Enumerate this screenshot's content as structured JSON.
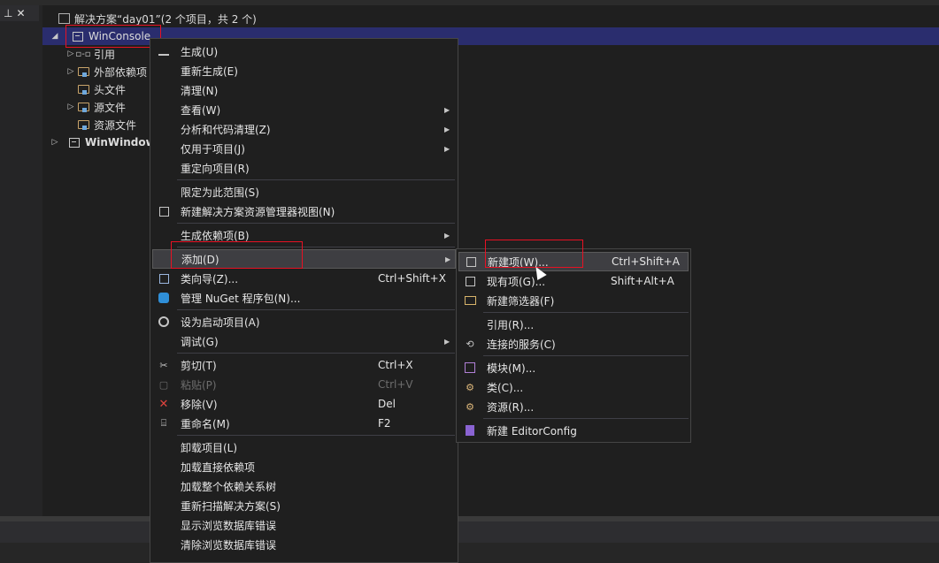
{
  "toolbar": {
    "pin_glyph": "⊥",
    "close_glyph": "✕"
  },
  "tree": {
    "solution": "解决方案“day01”(2 个项目，共 2 个)",
    "project1": "WinConsole",
    "children": [
      "引用",
      "外部依赖项",
      "头文件",
      "源文件",
      "资源文件"
    ],
    "project2": "WinWindow"
  },
  "context_menu": {
    "items": [
      {
        "label": "生成(U)",
        "shortcut": "",
        "arrow": false
      },
      {
        "label": "重新生成(E)",
        "shortcut": "",
        "arrow": false
      },
      {
        "label": "清理(N)",
        "shortcut": "",
        "arrow": false
      },
      {
        "label": "查看(W)",
        "shortcut": "",
        "arrow": true
      },
      {
        "label": "分析和代码清理(Z)",
        "shortcut": "",
        "arrow": true
      },
      {
        "label": "仅用于项目(J)",
        "shortcut": "",
        "arrow": true
      },
      {
        "label": "重定向项目(R)",
        "shortcut": "",
        "arrow": false
      },
      {
        "label": "限定为此范围(S)",
        "shortcut": "",
        "arrow": false
      },
      {
        "label": "新建解决方案资源管理器视图(N)",
        "shortcut": "",
        "arrow": false
      },
      {
        "label": "生成依赖项(B)",
        "shortcut": "",
        "arrow": true
      },
      {
        "label": "添加(D)",
        "shortcut": "",
        "arrow": true
      },
      {
        "label": "类向导(Z)...",
        "shortcut": "Ctrl+Shift+X",
        "arrow": false
      },
      {
        "label": "管理 NuGet 程序包(N)...",
        "shortcut": "",
        "arrow": false
      },
      {
        "label": "设为启动项目(A)",
        "shortcut": "",
        "arrow": false
      },
      {
        "label": "调试(G)",
        "shortcut": "",
        "arrow": true
      },
      {
        "label": "剪切(T)",
        "shortcut": "Ctrl+X",
        "arrow": false
      },
      {
        "label": "粘贴(P)",
        "shortcut": "Ctrl+V",
        "arrow": false
      },
      {
        "label": "移除(V)",
        "shortcut": "Del",
        "arrow": false
      },
      {
        "label": "重命名(M)",
        "shortcut": "F2",
        "arrow": false
      },
      {
        "label": "卸载项目(L)",
        "shortcut": "",
        "arrow": false
      },
      {
        "label": "加载直接依赖项",
        "shortcut": "",
        "arrow": false
      },
      {
        "label": "加载整个依赖关系树",
        "shortcut": "",
        "arrow": false
      },
      {
        "label": "重新扫描解决方案(S)",
        "shortcut": "",
        "arrow": false
      },
      {
        "label": "显示浏览数据库错误",
        "shortcut": "",
        "arrow": false
      },
      {
        "label": "清除浏览数据库错误",
        "shortcut": "",
        "arrow": false
      }
    ]
  },
  "submenu": {
    "items": [
      {
        "label": "新建项(W)...",
        "shortcut": "Ctrl+Shift+A"
      },
      {
        "label": "现有项(G)...",
        "shortcut": "Shift+Alt+A"
      },
      {
        "label": "新建筛选器(F)",
        "shortcut": ""
      },
      {
        "label": "引用(R)...",
        "shortcut": ""
      },
      {
        "label": "连接的服务(C)",
        "shortcut": ""
      },
      {
        "label": "模块(M)...",
        "shortcut": ""
      },
      {
        "label": "类(C)...",
        "shortcut": ""
      },
      {
        "label": "资源(R)...",
        "shortcut": ""
      },
      {
        "label": "新建 EditorConfig",
        "shortcut": ""
      }
    ]
  },
  "colors": {
    "highlight": "#e81123",
    "selection": "#2a2d6e",
    "menu_bg": "#1f1f1f"
  }
}
